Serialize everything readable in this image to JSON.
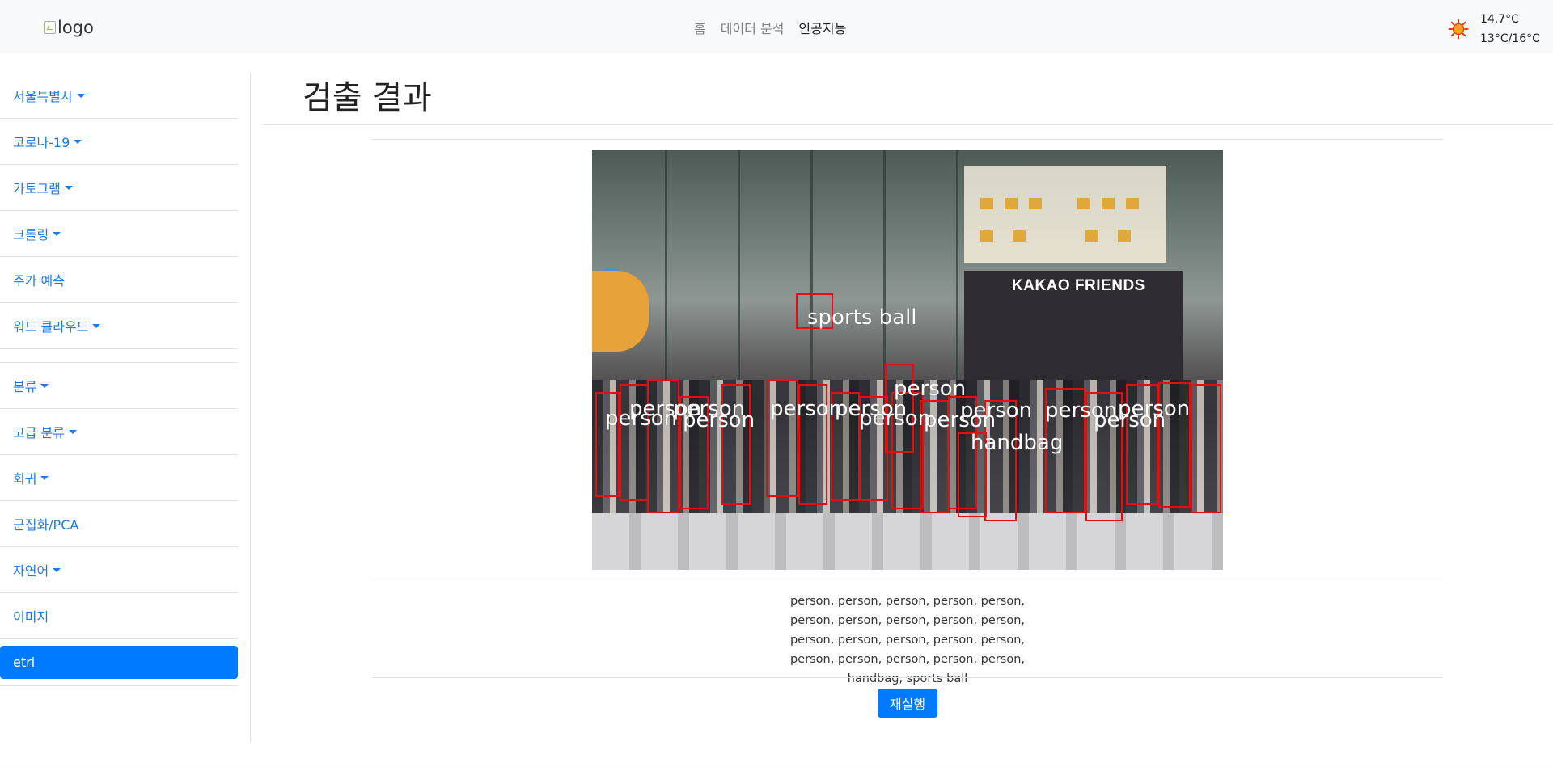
{
  "header": {
    "logo_alt": "logo",
    "nav": [
      {
        "label": "홈"
      },
      {
        "label": "데이터 분석"
      },
      {
        "label": "인공지능"
      }
    ],
    "weather": {
      "icon": "sun-icon",
      "current_temp": "14.7°C",
      "min_max": "13°C/16°C"
    }
  },
  "sidebar": {
    "items": [
      {
        "label": "서울특별시",
        "dropdown": true
      },
      {
        "label": "코로나-19",
        "dropdown": true
      },
      {
        "label": "카토그램",
        "dropdown": true
      },
      {
        "label": "크롤링",
        "dropdown": true
      },
      {
        "label": "주가 예측",
        "dropdown": false
      },
      {
        "label": "워드 클라우드",
        "dropdown": true
      },
      {
        "label": "분류",
        "dropdown": true
      },
      {
        "label": "고급 분류",
        "dropdown": true
      },
      {
        "label": "회귀",
        "dropdown": true
      },
      {
        "label": "군집화/PCA",
        "dropdown": false
      },
      {
        "label": "자연어",
        "dropdown": true
      },
      {
        "label": "이미지",
        "dropdown": false
      },
      {
        "label": "etri",
        "dropdown": false,
        "active": true
      }
    ]
  },
  "main": {
    "title": "검출 결과",
    "image": {
      "store_sign": "KAKAO FRIENDS",
      "detection_labels": [
        "sports ball",
        "person",
        "handbag"
      ]
    },
    "result_text": "person, person, person, person, person, person, person, person, person, person, person, person, person, person, person, person, person, person, person, person, handbag, sports ball",
    "rerun_button": "재실행"
  },
  "colors": {
    "accent": "#007bff",
    "link": "#1e7be6",
    "detection_box": "#e01010"
  }
}
